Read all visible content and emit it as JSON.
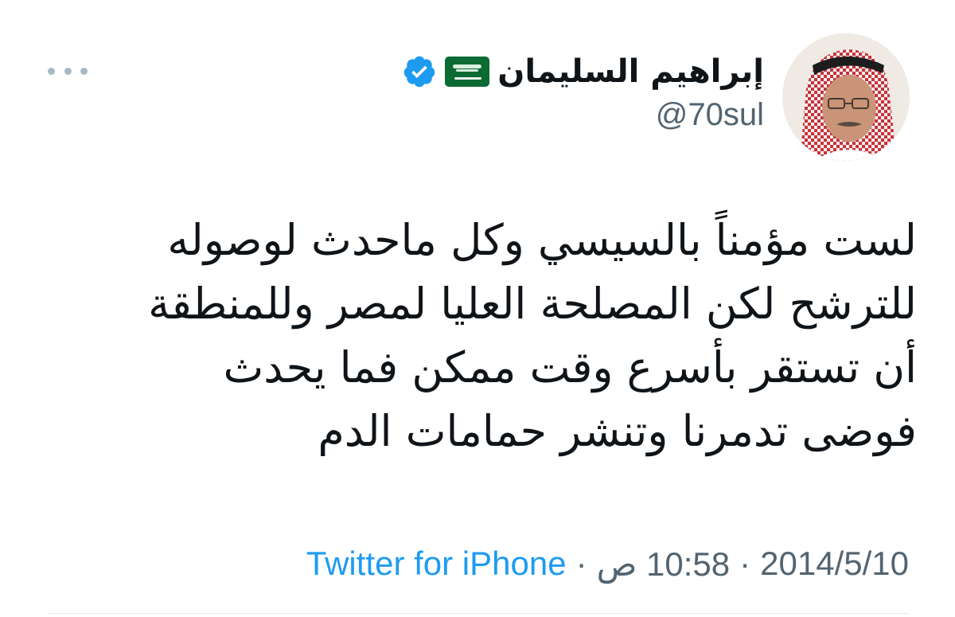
{
  "user": {
    "display_name": "إبراهيم السليمان",
    "handle": "@70sul",
    "flag_icon": "saudi-flag-emoji",
    "verified_icon": "verified-badge-icon",
    "verified_color": "#1d9bf0"
  },
  "tweet": {
    "lines": [
      "لست مؤمناً بالسيسي وكل ماحدث لوصوله",
      "للترشح لكن المصلحة العليا لمصر وللمنطقة",
      "أن تستقر بأسرع وقت ممكن فما يحدث",
      "فوضى تدمرنا وتنشر حمامات الدم"
    ]
  },
  "meta": {
    "date": "2014/5/10",
    "separator": "·",
    "time": "10:58 ص",
    "source": "Twitter for iPhone",
    "source_color": "#1d9bf0"
  },
  "more_icon": "more-dots-icon"
}
